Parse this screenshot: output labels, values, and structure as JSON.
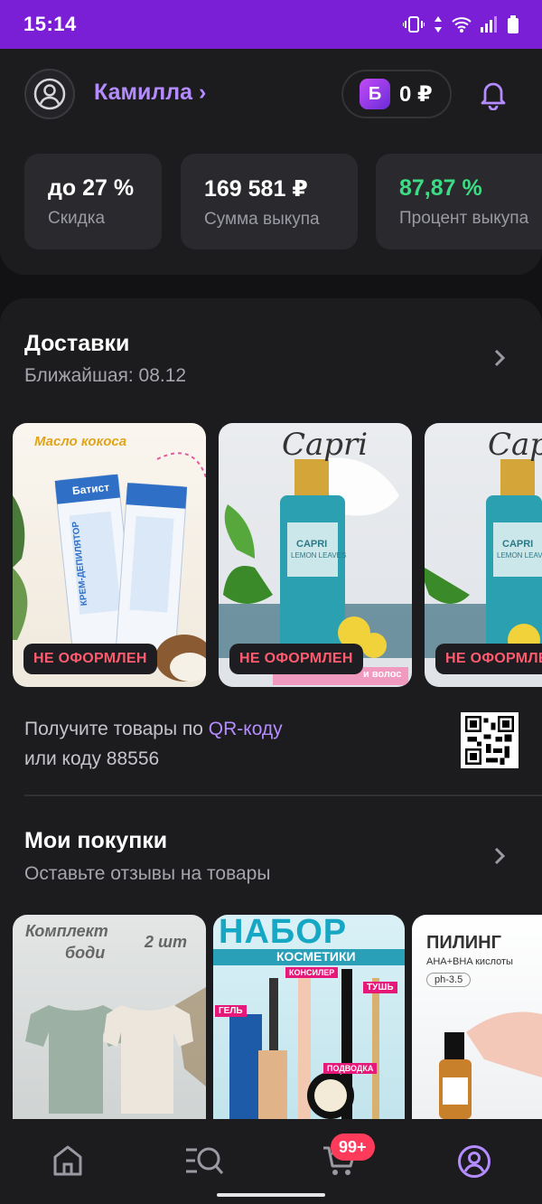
{
  "status_bar": {
    "time": "15:14"
  },
  "header": {
    "user_name": "Камилла ›",
    "balance_badge": "Б",
    "balance": "0 ₽"
  },
  "stats": [
    {
      "value": "до 27 %",
      "label": "Скидка",
      "value_color": "#ffffff"
    },
    {
      "value": "169 581 ₽",
      "label": "Сумма выкупа",
      "value_color": "#ffffff"
    },
    {
      "value": "87,87 %",
      "label": "Процент выкупа",
      "value_color": "#3ddc84"
    }
  ],
  "deliveries": {
    "title": "Доставки",
    "subtitle": "Ближайшая: 08.12",
    "items": [
      {
        "status": "НЕ ОФОРМЛЕН",
        "banner": "Масло кокоса",
        "product": "Батист",
        "product_sub": "КРЕМ-ДЕПИЛЯТОР"
      },
      {
        "status": "НЕ ОФОРМЛЕН",
        "banner": "Capri",
        "product": "CAPRI",
        "product_sub": "LEMON LEAVES",
        "footer": "и волос"
      },
      {
        "status": "НЕ ОФОРМЛЕН",
        "banner": "Capri",
        "product": "CAPRI",
        "product_sub": "LEMON LEAVES"
      }
    ],
    "qr_text_before": "Получите товары по ",
    "qr_link": "QR-коду",
    "qr_text_after": "или коду 88556"
  },
  "purchases": {
    "title": "Мои покупки",
    "subtitle": "Оставьте отзывы на товары",
    "items": [
      {
        "line1": "Комплект",
        "line2": "боди",
        "qty": "2 шт"
      },
      {
        "title": "НАБОР",
        "subtitle": "КОСМЕТИКИ",
        "tag1": "КОНСИЛЕР",
        "tag2": "ТУШЬ",
        "tag3": "ГЕЛЬ",
        "tag4": "ПОДВОДКА"
      },
      {
        "title": "ПИЛИНГ",
        "subtitle": "AHA+BHA кислоты",
        "ph": "ph-3.5"
      }
    ]
  },
  "bottom_nav": {
    "cart_badge": "99+"
  },
  "colors": {
    "accent": "#b48cff",
    "status_bar": "#7b1fd6",
    "error": "#ff5a6e",
    "success": "#3ddc84"
  }
}
